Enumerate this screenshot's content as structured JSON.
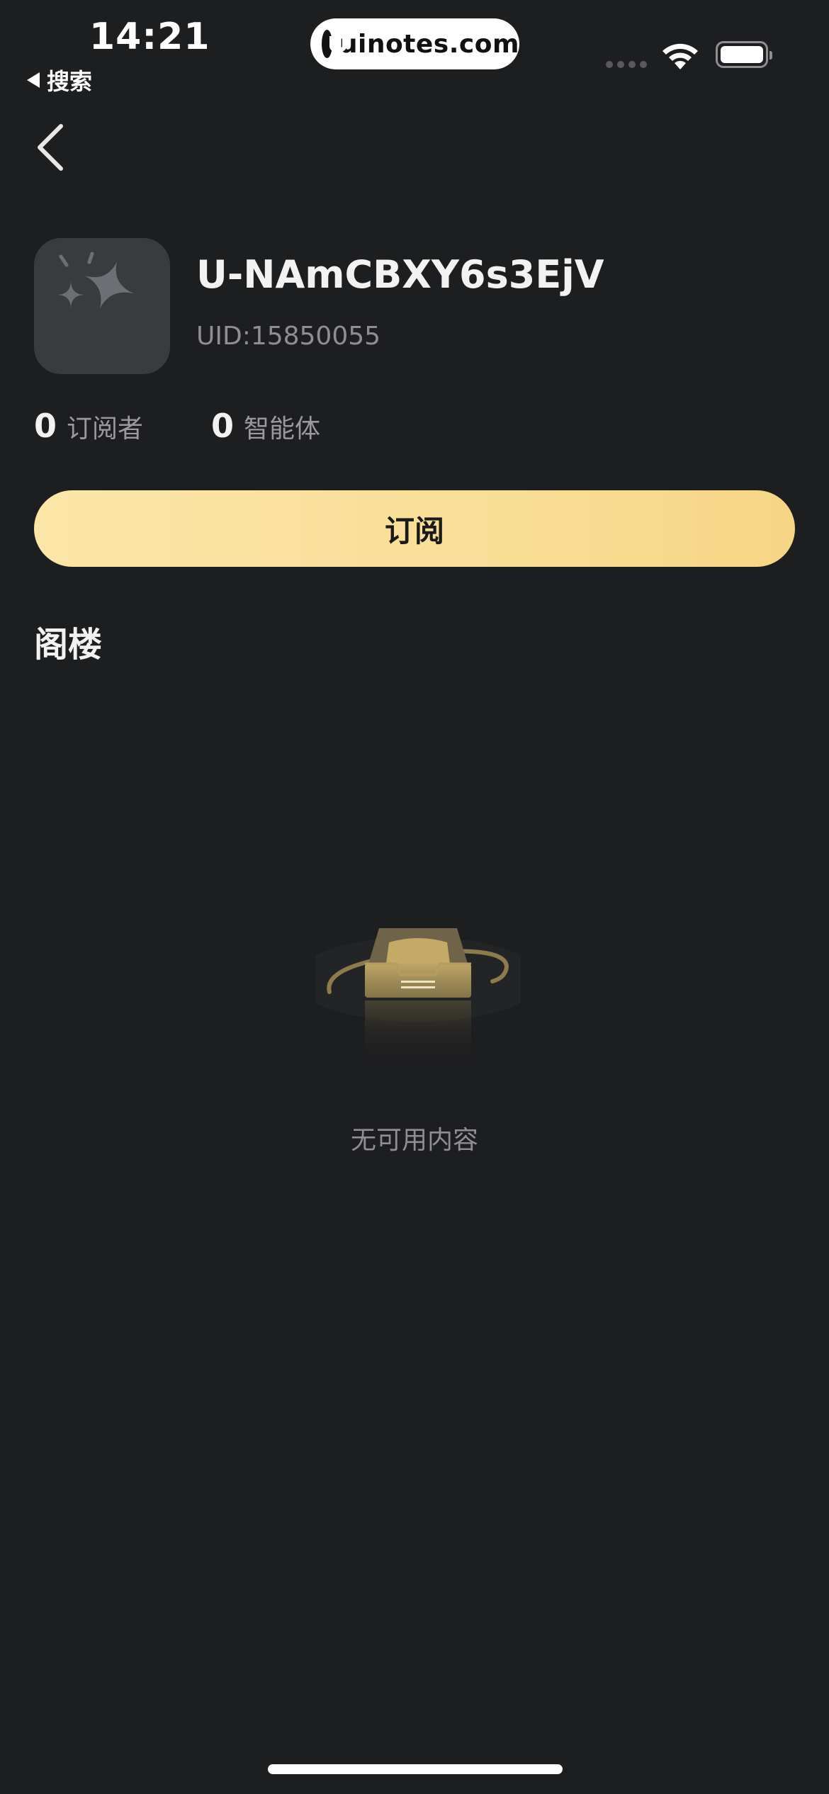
{
  "status_bar": {
    "time": "14:21",
    "back_app_label": "搜索",
    "watermark": "uinotes.com",
    "icons": [
      "signal-icon",
      "wifi-icon",
      "battery-icon"
    ]
  },
  "nav": {
    "back_icon": "chevron-left-icon"
  },
  "profile": {
    "avatar_icon": "sparkle-icon",
    "username": "U-NAmCBXY6s3EjV",
    "uid": "UID:15850055",
    "stats": [
      {
        "value": "0",
        "label": "订阅者"
      },
      {
        "value": "0",
        "label": "智能体"
      }
    ]
  },
  "subscribe_button": {
    "label": "订阅",
    "color": "#f9e09a"
  },
  "section": {
    "title": "阁楼"
  },
  "empty_state": {
    "icon": "empty-inbox-icon",
    "message": "无可用内容"
  },
  "colors": {
    "background": "#1d1e20",
    "accent": "#f8dc92",
    "avatar_bg": "#3a3b3f",
    "secondary_text": "#8e8e93"
  }
}
